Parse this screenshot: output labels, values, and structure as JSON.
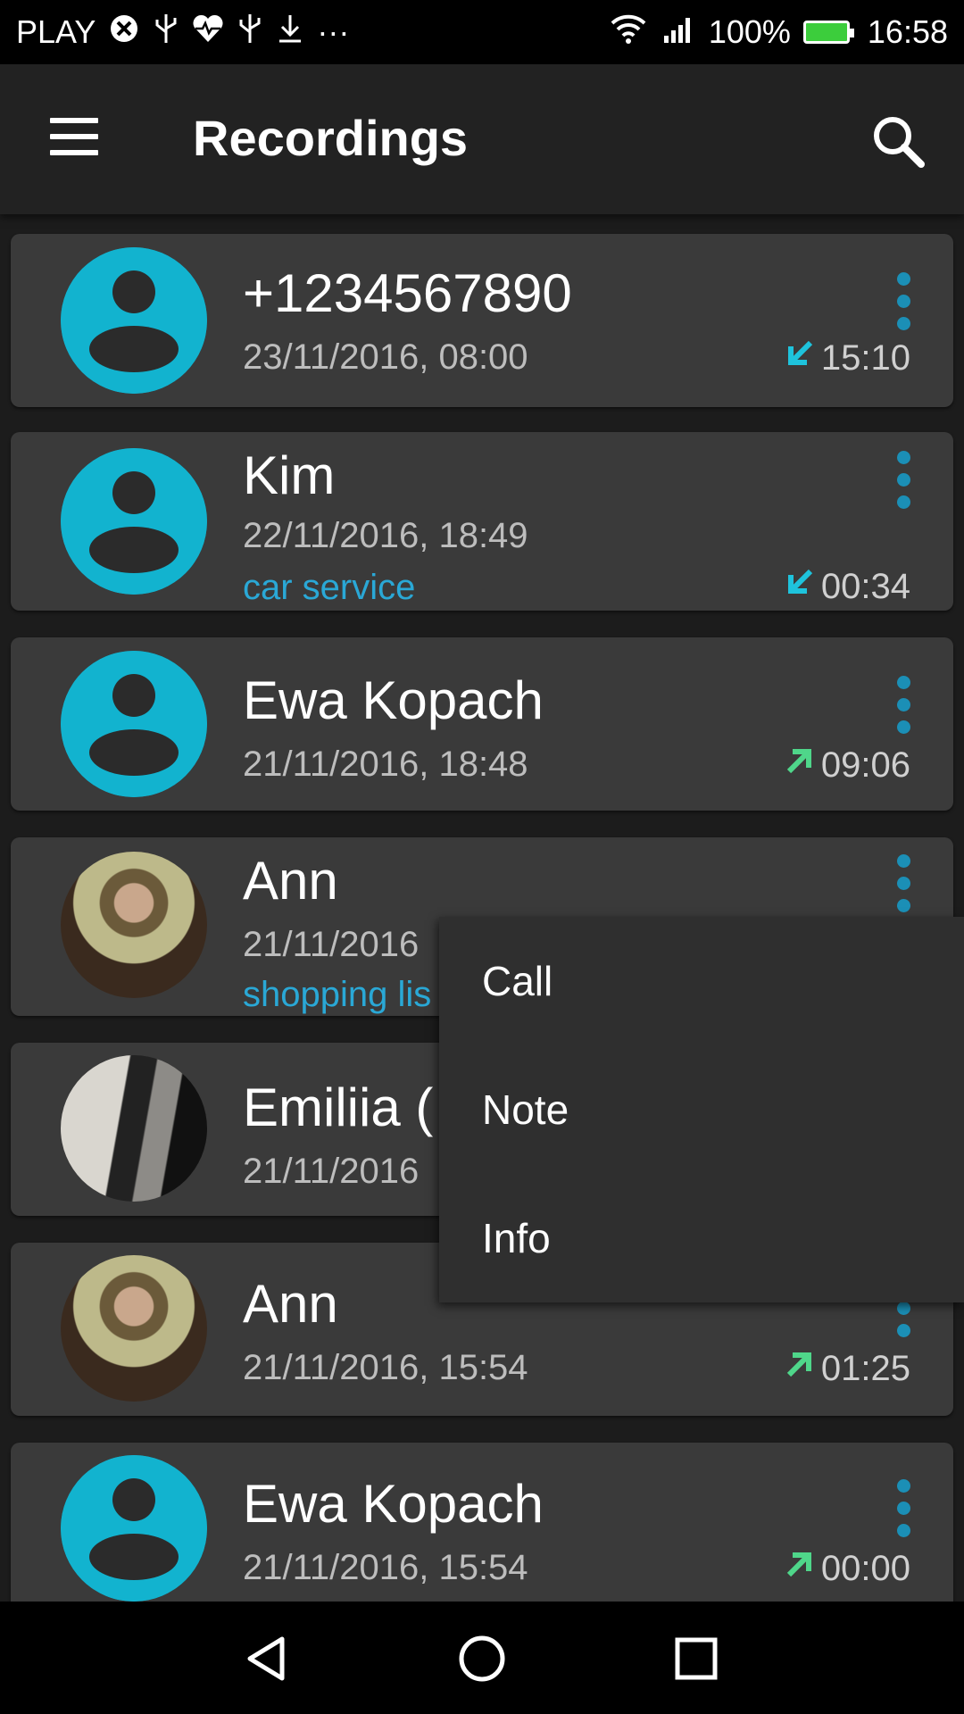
{
  "status_bar": {
    "carrier": "PLAY",
    "extra_icons": "···",
    "battery": "100%",
    "time": "16:58"
  },
  "app_bar": {
    "title": "Recordings"
  },
  "recordings": [
    {
      "name": "+1234567890",
      "date": "23/11/2016, 08:00",
      "note": "",
      "direction": "incoming",
      "duration": "15:10",
      "avatar": "generic"
    },
    {
      "name": "Kim",
      "date": "22/11/2016, 18:49",
      "note": "car service",
      "direction": "incoming",
      "duration": "00:34",
      "avatar": "generic"
    },
    {
      "name": "Ewa Kopach",
      "date": "21/11/2016, 18:48",
      "note": "",
      "direction": "outgoing",
      "duration": "09:06",
      "avatar": "generic"
    },
    {
      "name": "Ann",
      "date": "21/11/2016",
      "note": "shopping  lis",
      "direction": "",
      "duration": "",
      "avatar": "photo"
    },
    {
      "name": "Emiliia (",
      "date": "21/11/2016",
      "note": "",
      "direction": "",
      "duration": "",
      "avatar": "photo"
    },
    {
      "name": "Ann",
      "date": "21/11/2016, 15:54",
      "note": "",
      "direction": "outgoing",
      "duration": "01:25",
      "avatar": "photo"
    },
    {
      "name": "Ewa Kopach",
      "date": "21/11/2016, 15:54",
      "note": "",
      "direction": "outgoing",
      "duration": "00:00",
      "avatar": "generic"
    }
  ],
  "popup_menu": [
    "Call",
    "Note",
    "Info"
  ],
  "colors": {
    "accent": "#12b3cf",
    "incoming": "#1ec3dc",
    "outgoing": "#4fd68a",
    "note": "#2aa8d6"
  }
}
